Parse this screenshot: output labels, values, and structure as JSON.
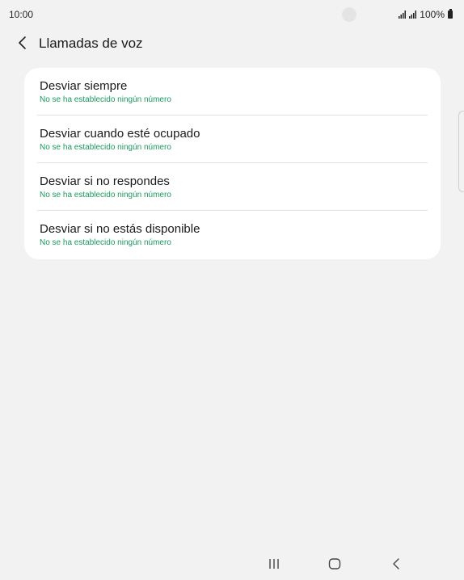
{
  "status_bar": {
    "time": "10:00",
    "battery": "100%",
    "icons": [
      "signal-icon",
      "signal-icon",
      "battery-icon"
    ]
  },
  "header": {
    "back_icon": "chevron-left-icon",
    "title": "Llamadas de voz"
  },
  "forwarding_options": [
    {
      "title": "Desviar siempre",
      "subtitle": "No se ha establecido ningún número"
    },
    {
      "title": "Desviar cuando esté ocupado",
      "subtitle": "No se ha establecido ningún número"
    },
    {
      "title": "Desviar si no respondes",
      "subtitle": "No se ha establecido ningún número"
    },
    {
      "title": "Desviar si no estás disponible",
      "subtitle": "No se ha establecido ningún número"
    }
  ],
  "colors": {
    "background": "#f2f2f2",
    "card": "#ffffff",
    "subtitle_accent": "#1a9a5c"
  },
  "nav_bar": {
    "icons": [
      "recent-apps-icon",
      "home-icon",
      "back-icon"
    ]
  }
}
